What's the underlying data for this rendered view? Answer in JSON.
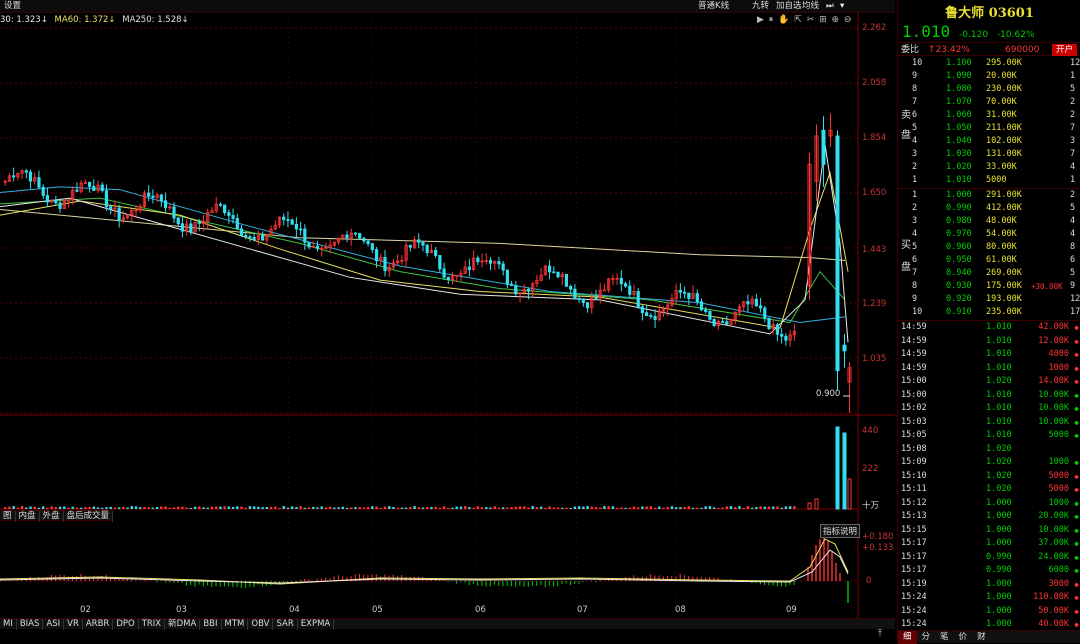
{
  "toolbar": {
    "settings": "设置",
    "kline_type": "普通K线",
    "nine_turn": "九转",
    "add_fav": "加自选",
    "avg_line": "均线"
  },
  "ma_legend": {
    "ma5": "30: 1.323↓",
    "ma60": "MA60: 1.372↓",
    "ma250": "MA250: 1.528↓"
  },
  "price_axis": [
    "2.262",
    "2.058",
    "1.854",
    "1.650",
    "1.443",
    "1.239",
    "1.035"
  ],
  "low_label": "0.900",
  "volume_axis": [
    "440",
    "222",
    "十万"
  ],
  "indicator_axis": [
    "+0.180",
    "+0.133",
    "0"
  ],
  "indicator_help": "指标说明",
  "volume_tabs": [
    "图",
    "内盘",
    "外盘",
    "盘后成交量"
  ],
  "date_labels": [
    "02",
    "03",
    "04",
    "05",
    "06",
    "07",
    "08",
    "09"
  ],
  "indicator_tabs": [
    "MI",
    "BIAS",
    "ASI",
    "VR",
    "ARBR",
    "DPO",
    "TRIX",
    "新DMA",
    "BBI",
    "MTM",
    "OBV",
    "SAR",
    "EXPMA"
  ],
  "stock": {
    "name": "鲁大师",
    "code": "03601",
    "price": "1.010",
    "change": "-0.120",
    "change_pct": "-10.62%"
  },
  "weibi": {
    "label": "委比",
    "value": "↑23.42%",
    "diff": "690000",
    "open_account": "开户"
  },
  "sell_label": [
    "卖",
    "盘"
  ],
  "buy_label": [
    "买",
    "盘"
  ],
  "asks": [
    {
      "level": "10",
      "price": "1.100",
      "vol": "295.00K",
      "cnt": "12"
    },
    {
      "level": "9",
      "price": "1.090",
      "vol": "20.00K",
      "cnt": "1"
    },
    {
      "level": "8",
      "price": "1.080",
      "vol": "230.00K",
      "cnt": "5"
    },
    {
      "level": "7",
      "price": "1.070",
      "vol": "70.00K",
      "cnt": "2"
    },
    {
      "level": "6",
      "price": "1.060",
      "vol": "31.00K",
      "cnt": "2"
    },
    {
      "level": "5",
      "price": "1.050",
      "vol": "211.00K",
      "cnt": "7"
    },
    {
      "level": "4",
      "price": "1.040",
      "vol": "102.00K",
      "cnt": "3"
    },
    {
      "level": "3",
      "price": "1.030",
      "vol": "131.00K",
      "cnt": "7"
    },
    {
      "level": "2",
      "price": "1.020",
      "vol": "33.00K",
      "cnt": "4"
    },
    {
      "level": "1",
      "price": "1.010",
      "vol": "5000",
      "cnt": "1"
    }
  ],
  "bids": [
    {
      "level": "1",
      "price": "1.000",
      "vol": "291.00K",
      "cnt": "2",
      "ext": ""
    },
    {
      "level": "2",
      "price": "0.990",
      "vol": "412.00K",
      "cnt": "5",
      "ext": ""
    },
    {
      "level": "3",
      "price": "0.980",
      "vol": "48.00K",
      "cnt": "4",
      "ext": ""
    },
    {
      "level": "4",
      "price": "0.970",
      "vol": "54.00K",
      "cnt": "4",
      "ext": ""
    },
    {
      "level": "5",
      "price": "0.960",
      "vol": "80.00K",
      "cnt": "8",
      "ext": ""
    },
    {
      "level": "6",
      "price": "0.950",
      "vol": "61.00K",
      "cnt": "6",
      "ext": ""
    },
    {
      "level": "7",
      "price": "0.940",
      "vol": "269.00K",
      "cnt": "5",
      "ext": ""
    },
    {
      "level": "8",
      "price": "0.930",
      "vol": "175.00K",
      "cnt": "9",
      "ext": "+30.00K"
    },
    {
      "level": "9",
      "price": "0.920",
      "vol": "193.00K",
      "cnt": "12",
      "ext": ""
    },
    {
      "level": "10",
      "price": "0.910",
      "vol": "235.00K",
      "cnt": "17",
      "ext": ""
    }
  ],
  "ticks": [
    {
      "time": "14:59",
      "price": "1.010",
      "vol": "42.00K",
      "dir": "sell"
    },
    {
      "time": "14:59",
      "price": "1.010",
      "vol": "12.00K",
      "dir": "sell"
    },
    {
      "time": "14:59",
      "price": "1.010",
      "vol": "4000",
      "dir": "sell"
    },
    {
      "time": "14:59",
      "price": "1.010",
      "vol": "1000",
      "dir": "sell"
    },
    {
      "time": "15:00",
      "price": "1.020",
      "vol": "14.00K",
      "dir": "sell"
    },
    {
      "time": "15:00",
      "price": "1.010",
      "vol": "10.00K",
      "dir": "buy"
    },
    {
      "time": "15:02",
      "price": "1.010",
      "vol": "10.00K",
      "dir": "buy"
    },
    {
      "time": "15:03",
      "price": "1.010",
      "vol": "10.00K",
      "dir": "buy"
    },
    {
      "time": "15:05",
      "price": "1.010",
      "vol": "5000",
      "dir": "buy"
    },
    {
      "time": "15:08",
      "price": "1.020",
      "vol": "",
      "dir": ""
    },
    {
      "time": "15:09",
      "price": "1.020",
      "vol": "1000",
      "dir": "buy"
    },
    {
      "time": "15:10",
      "price": "1.020",
      "vol": "5000",
      "dir": "sell"
    },
    {
      "time": "15:11",
      "price": "1.020",
      "vol": "5000",
      "dir": "sell"
    },
    {
      "time": "15:12",
      "price": "1.000",
      "vol": "1000",
      "dir": "buy"
    },
    {
      "time": "15:13",
      "price": "1.000",
      "vol": "20.00K",
      "dir": "buy"
    },
    {
      "time": "15:15",
      "price": "1.000",
      "vol": "10.00K",
      "dir": "buy"
    },
    {
      "time": "15:17",
      "price": "1.000",
      "vol": "37.00K",
      "dir": "buy"
    },
    {
      "time": "15:17",
      "price": "0.990",
      "vol": "24.00K",
      "dir": "buy"
    },
    {
      "time": "15:17",
      "price": "0.990",
      "vol": "6000",
      "dir": "buy"
    },
    {
      "time": "15:19",
      "price": "1.000",
      "vol": "3000",
      "dir": "sell"
    },
    {
      "time": "15:24",
      "price": "1.000",
      "vol": "110.00K",
      "dir": "sell"
    },
    {
      "time": "15:24",
      "price": "1.000",
      "vol": "50.00K",
      "dir": "sell"
    },
    {
      "time": "15:24",
      "price": "1.000",
      "vol": "40.00K",
      "dir": "sell"
    }
  ],
  "right_tabs": [
    "细",
    "分",
    "笔",
    "价",
    "财"
  ],
  "colors": {
    "up": "#ff3333",
    "down": "#00cc00",
    "text_yellow": "#e8e030",
    "cyan": "#30e0f0",
    "bg": "#000000",
    "grid": "#5a0000"
  }
}
